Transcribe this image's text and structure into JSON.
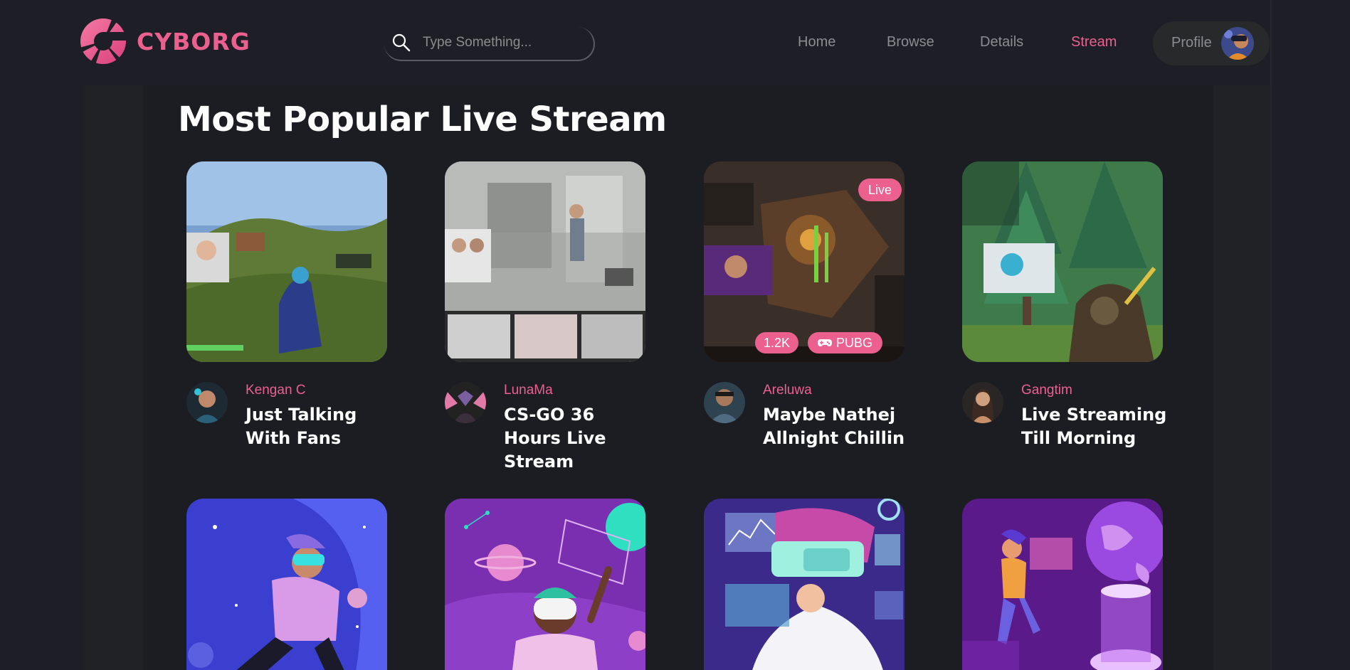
{
  "brand": {
    "name": "CYBORG",
    "accent": "#ec6090"
  },
  "search": {
    "placeholder": "Type Something..."
  },
  "nav": {
    "items": [
      {
        "label": "Home"
      },
      {
        "label": "Browse"
      },
      {
        "label": "Details"
      },
      {
        "label": "Stream",
        "active": true
      }
    ],
    "profile_label": "Profile"
  },
  "section": {
    "title": "Most Popular Live Stream"
  },
  "streams": [
    {
      "author": "Kengan C",
      "title": "Just Talking With Fans"
    },
    {
      "author": "LunaMa",
      "title": "CS-GO 36 Hours Live Stream"
    },
    {
      "author": "Areluwa",
      "title": "Maybe Nathej Allnight Chillin",
      "live_label": "Live",
      "views": "1.2K",
      "game": "PUBG"
    },
    {
      "author": "Gangtim",
      "title": "Live Streaming Till Morning"
    }
  ],
  "icons": {
    "search": "search-icon",
    "gamepad": "gamepad-icon",
    "logo": "logo-mark-icon"
  }
}
